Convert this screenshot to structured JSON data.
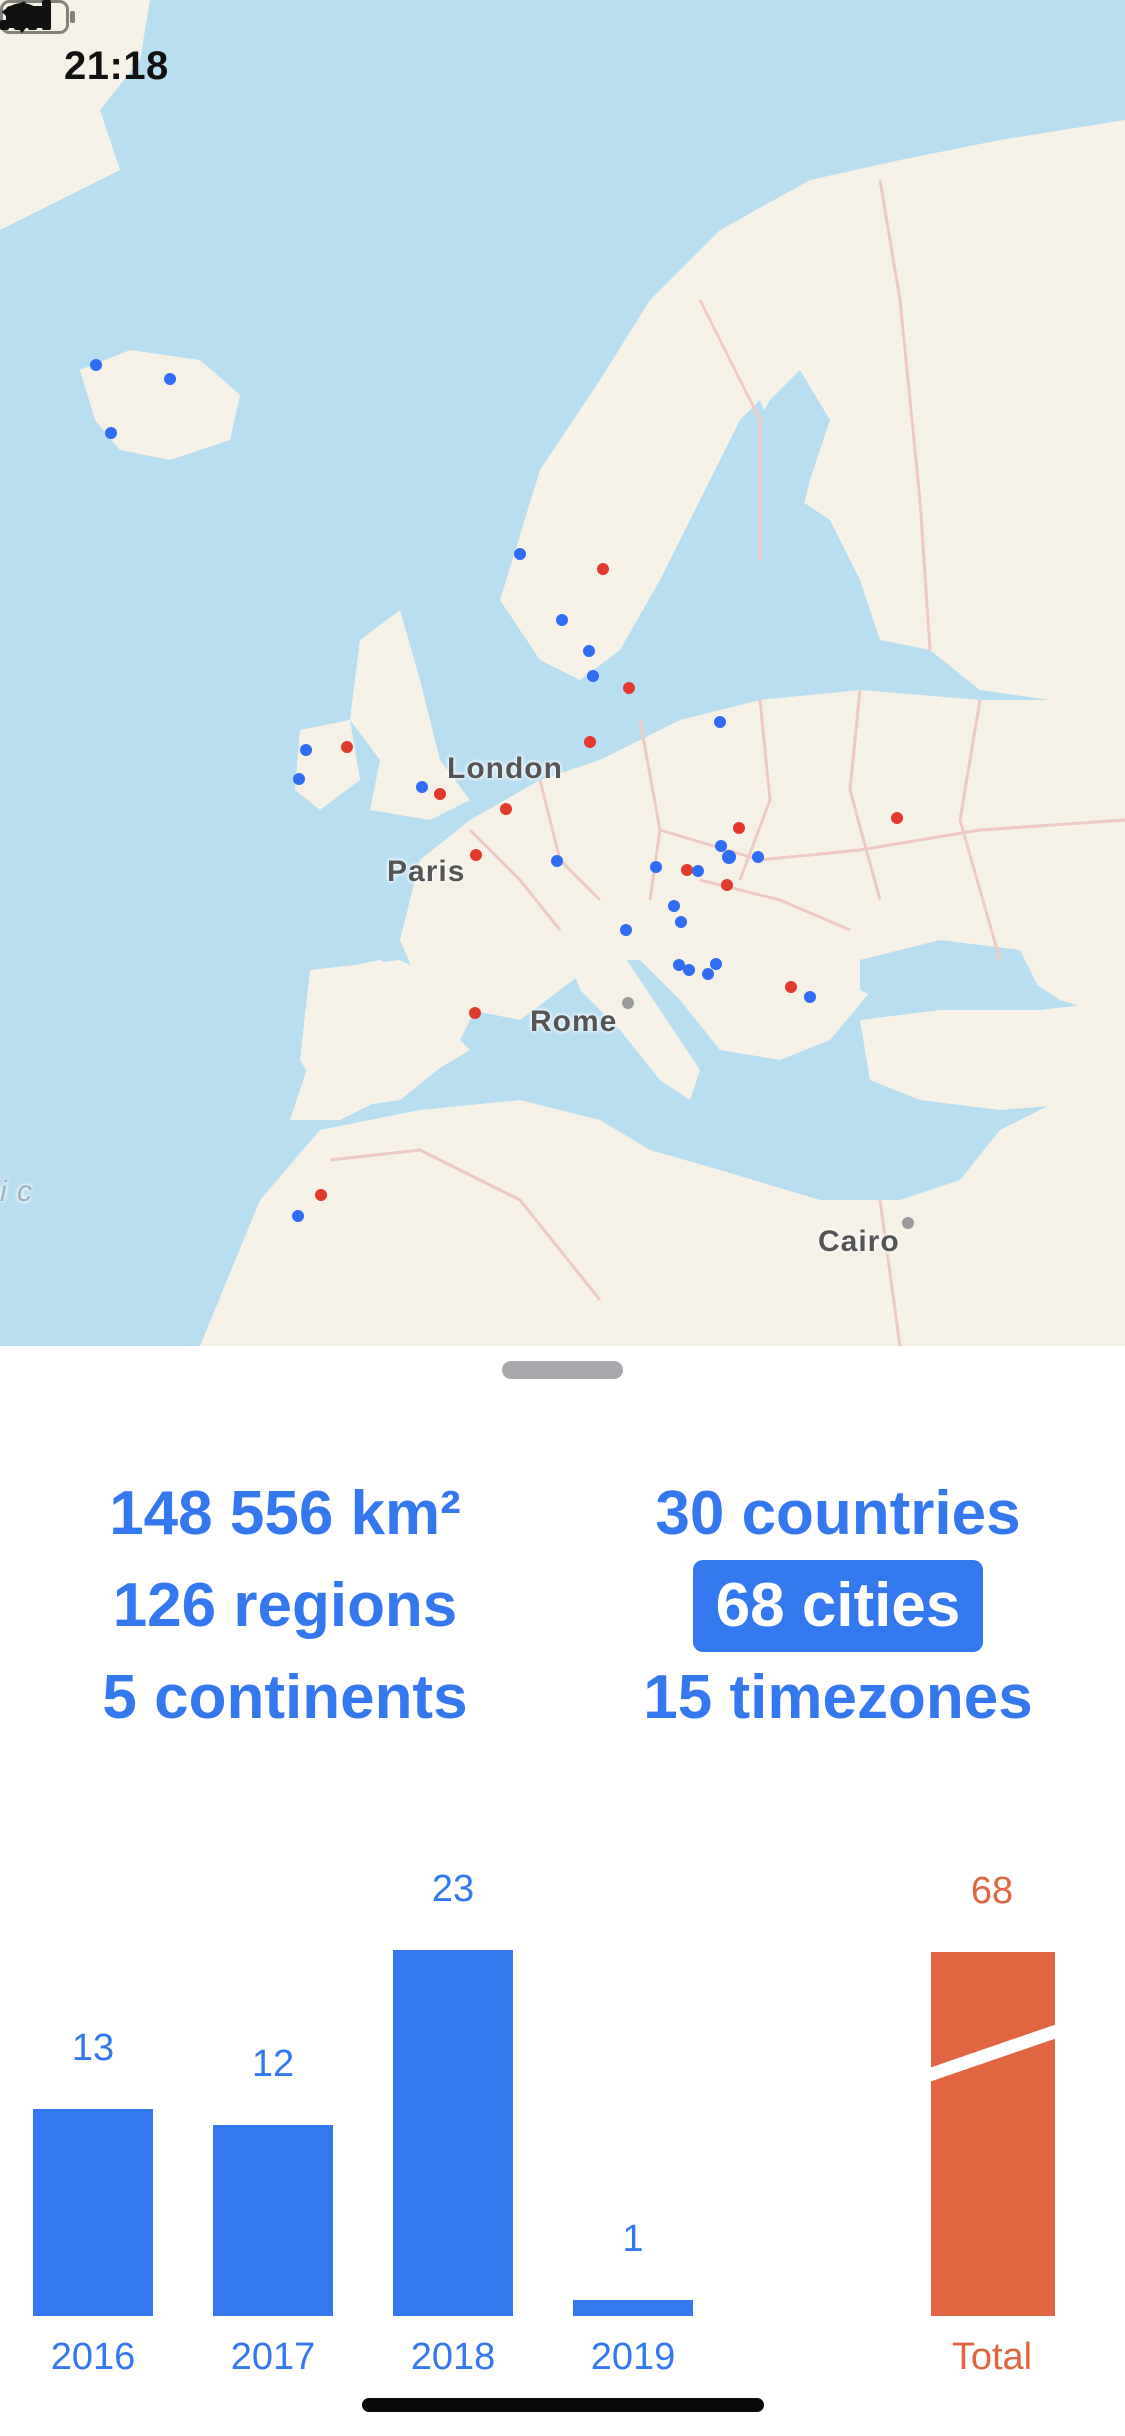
{
  "status_bar": {
    "time": "21:18"
  },
  "map": {
    "labels": {
      "london": "London",
      "paris": "Paris",
      "rome": "Rome",
      "cairo": "Cairo",
      "edge": "i c"
    },
    "colors": {
      "water": "#b8def2",
      "land": "#f6f1e6",
      "border": "#efc9c4",
      "visited_blue": "#2f6df6",
      "visited_red": "#e23a2c"
    }
  },
  "stats": {
    "area": "148 556 km²",
    "countries": "30 countries",
    "regions": "126 regions",
    "cities": "68 cities",
    "continents": "5 continents",
    "timezones": "15 timezones",
    "selected": "cities"
  },
  "chart_data": {
    "type": "bar",
    "categories": [
      "2016",
      "2017",
      "2018",
      "2019"
    ],
    "values": [
      13,
      12,
      23,
      1
    ],
    "total": {
      "label": "Total",
      "value": 68
    },
    "colors": {
      "bar": "#3478f0",
      "total": "#e06540"
    }
  }
}
